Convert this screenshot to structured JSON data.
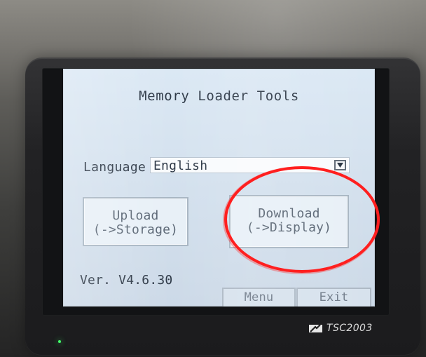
{
  "screen": {
    "title": "Memory Loader Tools",
    "language_label": "Language",
    "language_value": "English",
    "upload_button": "Upload\n(->Storage)",
    "download_button": "Download\n(->Display)",
    "version": "Ver. V4.6.30",
    "menu_tab": "Menu",
    "exit_tab": "Exit"
  },
  "device": {
    "brand": "TSC2003"
  },
  "icons": {
    "dropdown": "chevron-down-icon",
    "brand_logo": "brand-logo-icon"
  },
  "colors": {
    "annotation_circle": "#ff1f1f",
    "screen_background": "#d4e1ee"
  }
}
